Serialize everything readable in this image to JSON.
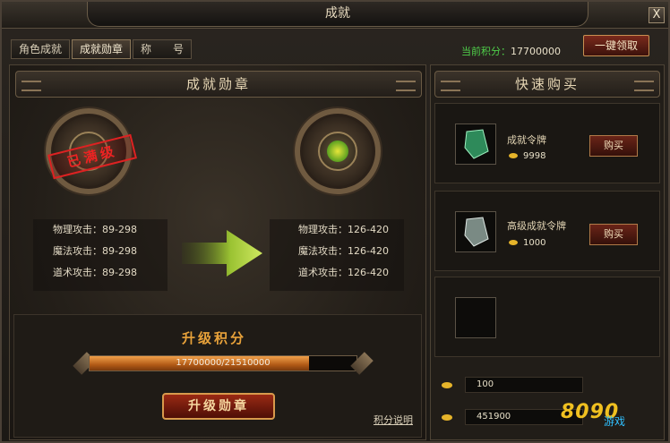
{
  "window": {
    "title": "成就",
    "close_label": "X"
  },
  "tabs": [
    {
      "label": "角色成就",
      "active": false
    },
    {
      "label": "成就勋章",
      "active": true
    },
    {
      "label": "称　　号",
      "active": false
    }
  ],
  "header": {
    "score_label": "当前积分：",
    "score_value": "17700000",
    "claim_label": "一键领取"
  },
  "medal_panel": {
    "title": "成就勋章",
    "current": {
      "stamp": "已满级",
      "stats": [
        {
          "label": "物理攻击：",
          "value": "89-298"
        },
        {
          "label": "魔法攻击：",
          "value": "89-298"
        },
        {
          "label": "道术攻击：",
          "value": "89-298"
        }
      ]
    },
    "next": {
      "stats": [
        {
          "label": "物理攻击：",
          "value": "126-420"
        },
        {
          "label": "魔法攻击：",
          "value": "126-420"
        },
        {
          "label": "道术攻击：",
          "value": "126-420"
        }
      ]
    }
  },
  "upgrade": {
    "title": "升级积分",
    "progress_text": "17700000/21510000",
    "progress_fraction": 0.823,
    "button_label": "升级勋章",
    "help_label": "积分说明"
  },
  "shop": {
    "title": "快速购买",
    "items": [
      {
        "name": "成就令牌",
        "price": "9998",
        "buy_label": "购买",
        "icon": "green-token-icon"
      },
      {
        "name": "高级成就令牌",
        "price": "1000",
        "buy_label": "购买",
        "icon": "silver-token-icon"
      }
    ],
    "empty_slot_icon": "empty-slot"
  },
  "currency": {
    "gold": "100",
    "bound_gold": "451900"
  },
  "watermark": {
    "text": "8090",
    "sub": "游戏"
  },
  "colors": {
    "accent_green": "#4fd04a",
    "accent_orange": "#e8a23a",
    "button_red": "#7a2a1c"
  }
}
